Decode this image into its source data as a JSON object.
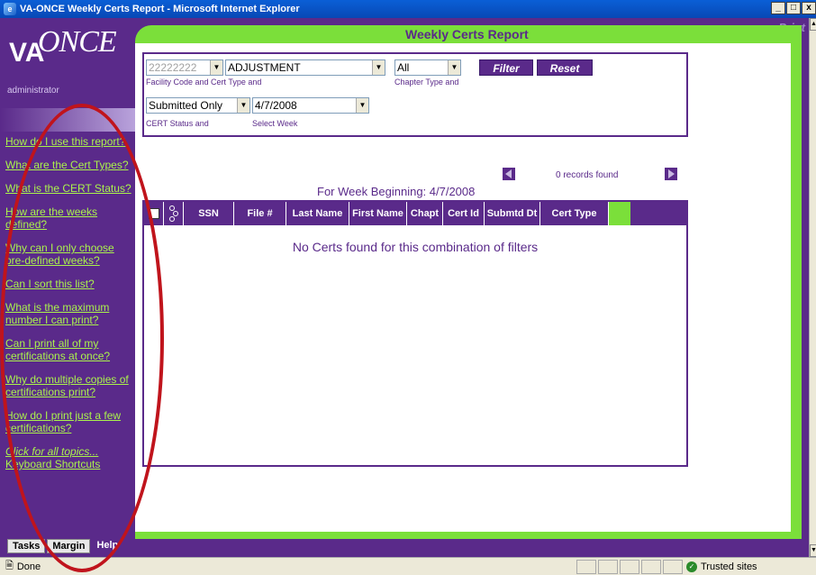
{
  "window": {
    "title": "VA-ONCE Weekly Certs Report - Microsoft Internet Explorer",
    "buttons": [
      "_",
      "□",
      "x"
    ]
  },
  "app": {
    "logo_va": "VA",
    "logo_once": "ONCE",
    "user": "administrator",
    "page_title": "Weekly Certs Report",
    "print_label": "Print"
  },
  "sidebar": {
    "links": [
      "How do I use this report?",
      "What are the Cert Types?",
      "What is the CERT Status?",
      "How are the weeks defined?",
      "Why can I only choose pre-defined weeks?",
      "Can I sort this list?",
      "What is the maximum number I can print?",
      "Can I print all of my certifications at once?",
      "Why do multiple copies of certifications print?",
      "How do I print just a few certifications?"
    ],
    "all_topics": "Click for all topics...",
    "shortcuts": "Keyboard Shortcuts",
    "tabs": [
      "Tasks",
      "Margin",
      "Help"
    ]
  },
  "filters": {
    "facility_code": "22222222",
    "cert_type": "ADJUSTMENT",
    "chapter_type": "All",
    "label_facility": "Facility Code and Cert Type and",
    "label_chapter": "Chapter Type and",
    "cert_status": "Submitted Only",
    "week": "4/7/2008",
    "label_status": "CERT Status and",
    "label_week": "Select Week",
    "filter_btn": "Filter",
    "reset_btn": "Reset"
  },
  "results": {
    "records_found": "0 records found",
    "week_heading": "For Week Beginning: 4/7/2008",
    "columns": [
      "SSN",
      "File #",
      "Last Name",
      "First Name",
      "Chapt",
      "Cert Id",
      "Submtd Dt",
      "Cert Type"
    ],
    "empty_message": "No Certs found for this combination of filters"
  },
  "statusbar": {
    "left": "Done",
    "zone": "Trusted sites"
  },
  "colors": {
    "purple": "#5a2a8a",
    "green": "#7bdf3a",
    "link": "#aaf24c",
    "annotation": "#c0141c"
  }
}
